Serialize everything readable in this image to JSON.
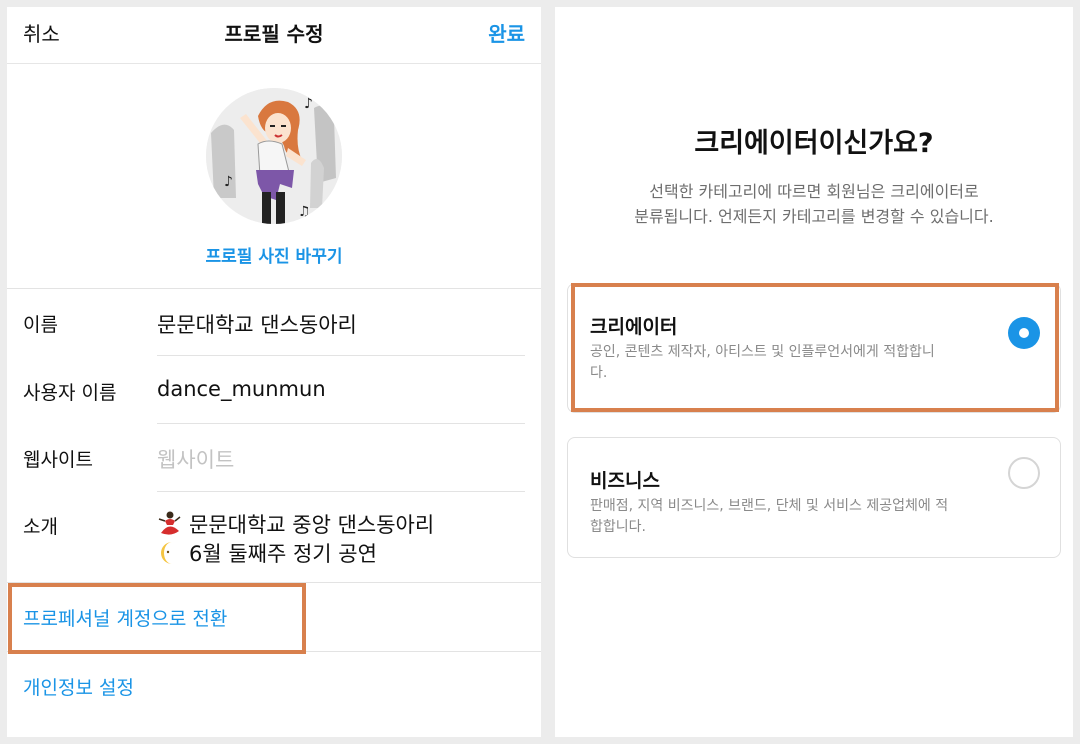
{
  "edit_profile": {
    "cancel_label": "취소",
    "title": "프로필 수정",
    "done_label": "완료",
    "change_photo_label": "프로필 사진 바꾸기",
    "fields": {
      "name": {
        "label": "이름",
        "value": "문문대학교 댄스동아리"
      },
      "username": {
        "label": "사용자 이름",
        "value": "dance_munmun"
      },
      "website": {
        "label": "웹사이트",
        "placeholder": "웹사이트"
      },
      "bio": {
        "label": "소개",
        "line1": "문문대학교 중앙 댄스동아리",
        "line1_icon": "dancer-emoji-icon",
        "line2": "6월 둘째주 정기 공연",
        "line2_icon": "crescent-moon-emoji-icon"
      }
    },
    "switch_professional_label": "프로페셔널 계정으로 전환",
    "privacy_settings_label": "개인정보 설정"
  },
  "account_type": {
    "title": "크리에이터이신가요?",
    "subtitle_line1": "선택한 카테고리에 따르면 회원님은 크리에이터로",
    "subtitle_line2": "분류됩니다. 언제든지 카테고리를 변경할 수 있습니다.",
    "options": [
      {
        "title": "크리에이터",
        "desc_line1": "공인, 콘텐츠 제작자, 아티스트 및 인플루언서에게 적합합니",
        "desc_line2": "다.",
        "selected": true
      },
      {
        "title": "비즈니스",
        "desc_line1": "판매점, 지역 비즈니스, 브랜드, 단체 및 서비스 제공업체에 적",
        "desc_line2": "합합니다.",
        "selected": false
      }
    ]
  },
  "colors": {
    "accent": "#1a94e6",
    "highlight": "#d8804d",
    "muted": "#8a8a8a"
  }
}
